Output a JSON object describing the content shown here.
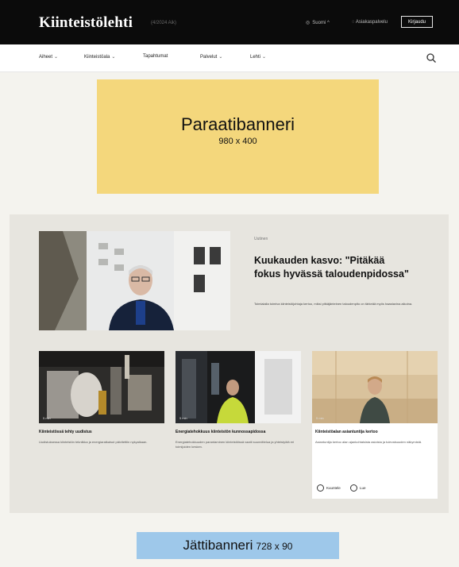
{
  "header": {
    "logo": "Kiinteistölehti",
    "subtitle": "(4/2024 Aik)",
    "language": "Suomi",
    "language_chevron": "^",
    "customer_service": "Asiakaspalvelu",
    "login_label": "Kirjaudu"
  },
  "nav": {
    "items": [
      {
        "label": "Aiheet",
        "chev": "⌄"
      },
      {
        "label": "Kiinteistöala",
        "chev": "⌄"
      },
      {
        "label": "Tapahtumat",
        "chev": ""
      },
      {
        "label": "Palvelut",
        "chev": "⌄"
      },
      {
        "label": "Lehti",
        "chev": "⌄"
      }
    ]
  },
  "banners": {
    "paraati_name": "Paraatibanneri",
    "paraati_size": "980 x 400",
    "jatti_name": "Jättibanneri",
    "jatti_size": "728 x 90"
  },
  "hero": {
    "kicker": "Uutinen",
    "title": "Kuukauden kasvo: \"Pitäkää fokus hyvässä taloudenpidossa\"",
    "description": "Toimialalla toimiva kiinteistöjohtaja kertoo, miksi pitkäjänteinen taloudenpito on tärkeää myös haastavina aikoina."
  },
  "cards": [
    {
      "time": "5 min",
      "title": "Kiinteistössä tehty uudistus",
      "description": "Uudistuksessa kiinteistön tekniikka ja energiaratkaisut päivitettiin nykyaikaan."
    },
    {
      "time": "5 min",
      "title": "Energiatehokkuus kiinteistön kunnossapidossa",
      "description": "Energiatehokkuuden parantaminen kiinteistöissä vaatii suunnittelua ja yhteistyötä eri toimijoiden kesken."
    },
    {
      "time": "5 min",
      "title": "Kiinteistöalan asiantuntija kertoo",
      "description": "Asiantuntija kertoo alan ajankohtaisista asioista ja tulevaisuuden näkymistä.",
      "listen_label": "Kuuntele",
      "read_label": "Lue"
    }
  ],
  "colors": {
    "topbar": "#0b0b0b",
    "paraati_bg": "#f4d77c",
    "jatti_bg": "#9ec8ea",
    "section_bg": "#e7e5df"
  }
}
